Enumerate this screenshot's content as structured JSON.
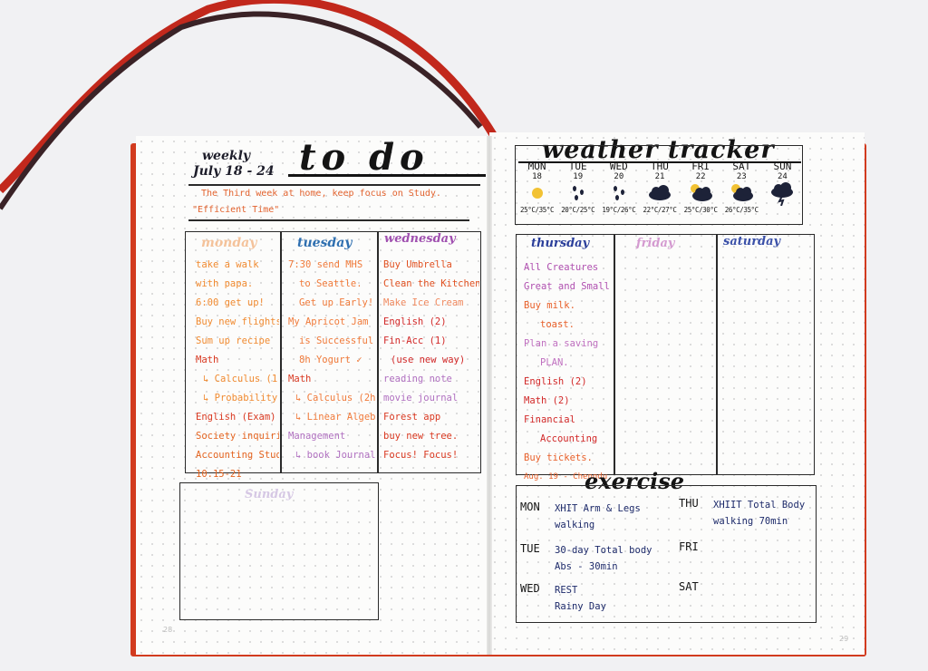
{
  "left_page": {
    "header": {
      "weekly": "weekly",
      "dates": "July 18 - 24",
      "big_title": "to do",
      "note_line1": "The Third week at home, keep focus on Study.",
      "note_line2": "\"Efficient Time\""
    },
    "days": {
      "monday": {
        "title": "monday",
        "items": [
          "take a walk",
          "with papa.",
          "6:00 get up!",
          "Buy new flights",
          "Sum up recipe",
          "Math",
          "↳ Calculus (1-14)",
          "↳ Probability theory",
          "English (Exam)",
          "Society inquiries",
          "Accounting Study",
          "10.15-21"
        ]
      },
      "tuesday": {
        "title": "tuesday",
        "items": [
          "7:30 send MHS",
          "to Seattle.",
          "Get up Early!",
          "My Apricot Jam",
          "is Successful!!",
          "8h Yogurt ✓",
          "Math",
          "↳ Calculus (2h)",
          "↳ Linear Algebra",
          "Management",
          "↳ book Journal ✓"
        ]
      },
      "wednesday": {
        "title": "wednesday",
        "items": [
          "Buy Umbrella",
          "Clean the Kitchen",
          "Make Ice Cream",
          "English (2)",
          "Fin-Acc (1)",
          "(use new way)",
          "reading note",
          "movie journal",
          "Forest app",
          "buy new tree.",
          "Focus! Focus!"
        ]
      },
      "sunday": {
        "title": "Sunday"
      }
    },
    "page_number": "28"
  },
  "right_page": {
    "title": "weather tracker",
    "weather": [
      {
        "day": "MON",
        "date": "18",
        "temp": "25°C/35°C",
        "icon": "sun-icon"
      },
      {
        "day": "TUE",
        "date": "19",
        "temp": "20°C/25°C",
        "icon": "rain-icon"
      },
      {
        "day": "WED",
        "date": "20",
        "temp": "19°C/26°C",
        "icon": "rain-icon"
      },
      {
        "day": "THU",
        "date": "21",
        "temp": "22°C/27°C",
        "icon": "cloud-icon"
      },
      {
        "day": "FRI",
        "date": "22",
        "temp": "25°C/30°C",
        "icon": "sun-cloud-icon"
      },
      {
        "day": "SAT",
        "date": "23",
        "temp": "26°C/35°C",
        "icon": "sun-cloud-icon"
      },
      {
        "day": "SUN",
        "date": "24",
        "temp": "",
        "icon": "storm-icon"
      }
    ],
    "days": {
      "thursday": {
        "title": "thursday",
        "items": [
          "All Creatures",
          "Great and Small",
          "Buy milk.",
          "toast.",
          "Plan a saving",
          "PLAN.",
          "English (2)",
          "Math (2)",
          "Financial",
          "Accounting",
          "Buy tickets.",
          "Aug. 19 - Chengdu"
        ]
      },
      "friday": {
        "title": "friday"
      },
      "saturday": {
        "title": "saturday"
      }
    },
    "exercise": {
      "title": "exercise",
      "rows": [
        {
          "day": "MON",
          "items": [
            "XHIT Arm & Legs",
            "walking"
          ]
        },
        {
          "day": "TUE",
          "items": [
            "30-day Total body",
            "Abs - 30min"
          ]
        },
        {
          "day": "WED",
          "items": [
            "REST",
            "Rainy Day"
          ]
        },
        {
          "day": "THU",
          "items": [
            "XHIIT Total Body",
            "walking 70min"
          ]
        },
        {
          "day": "FRI",
          "items": []
        },
        {
          "day": "SAT",
          "items": []
        }
      ]
    },
    "page_number": "29"
  },
  "colors": {
    "ribbon": "#c2281c",
    "cover": "#d23b1f",
    "monday_ink": "#f08a30",
    "tuesday_ink": "#f07a3a",
    "wednesday_ink": "#e05020",
    "thursday_ink": "#d22828",
    "tuesday_title": "#2e6fb0",
    "wednesday_title": "#a050b0",
    "thursday_title": "#2a3e9a",
    "friday_title": "#c868c0",
    "saturday_title": "#3a50a8",
    "exercise_ink": "#1d2a6a"
  }
}
